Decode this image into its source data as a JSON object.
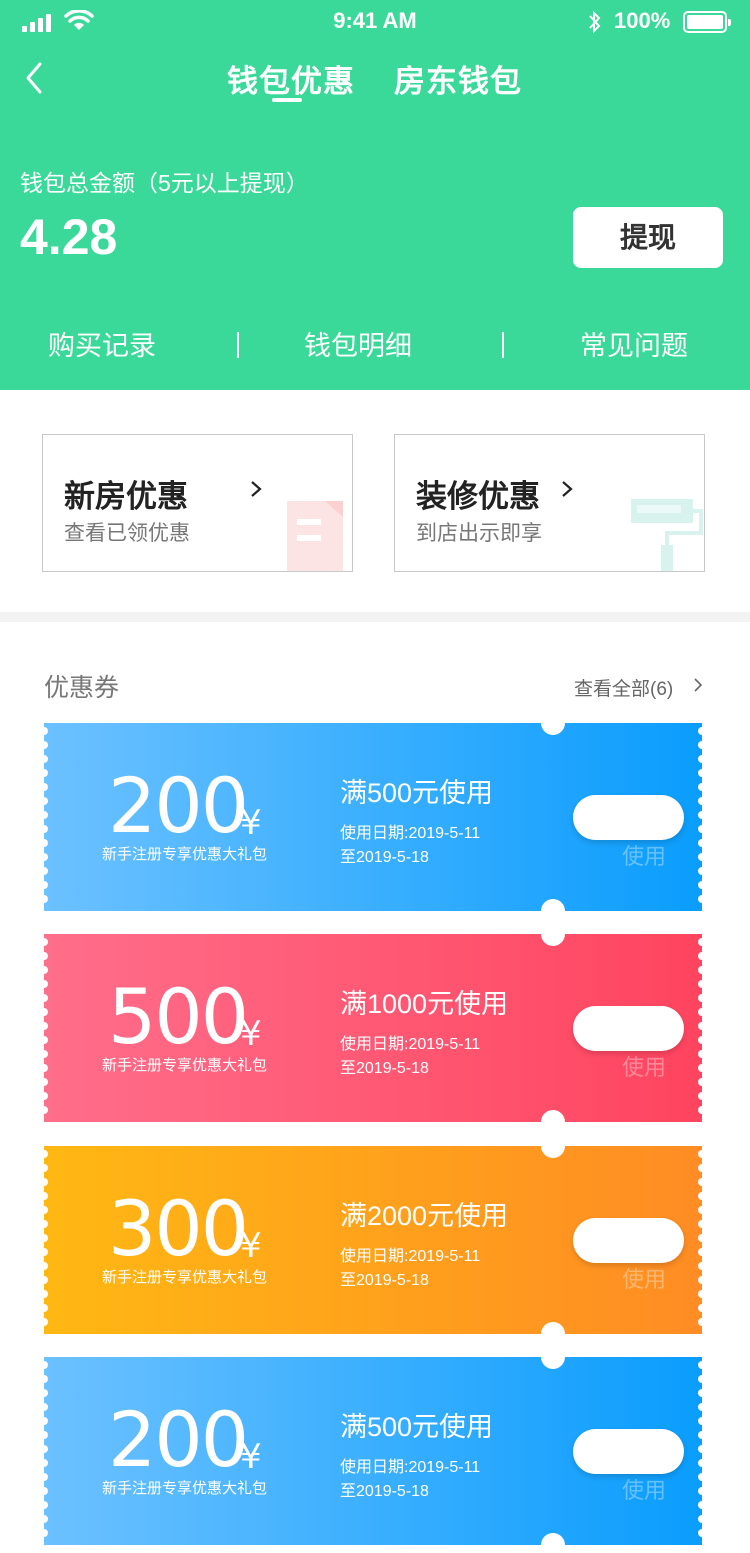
{
  "status_bar": {
    "time": "9:41 AM",
    "battery": "100%"
  },
  "nav": {
    "tabs": [
      "钱包优惠",
      "房东钱包"
    ]
  },
  "wallet": {
    "total_label": "钱包总金额（5元以上提现）",
    "total_amount": "4.28",
    "withdraw_label": "提现"
  },
  "links": [
    "购买记录",
    "钱包明细",
    "常见问题"
  ],
  "promos": [
    {
      "title": "新房优惠",
      "subtitle": "查看已领优惠"
    },
    {
      "title": "装修优惠",
      "subtitle": "到店出示即享"
    }
  ],
  "coupons_section": {
    "title": "优惠券",
    "view_all": "查看全部(6)"
  },
  "coupons": [
    {
      "amount": "200",
      "currency": "¥",
      "desc": "新手注册专享优惠大礼包",
      "condition": "满500元使用",
      "date_line1": "使用日期:2019-5-11",
      "date_line2": "至2019-5-18",
      "use_label": "使用",
      "colors": [
        "#6cc1ff",
        "#0a9dfd"
      ]
    },
    {
      "amount": "500",
      "currency": "¥",
      "desc": "新手注册专享优惠大礼包",
      "condition": "满1000元使用",
      "date_line1": "使用日期:2019-5-11",
      "date_line2": "至2019-5-18",
      "use_label": "使用",
      "colors": [
        "#ff6e8a",
        "#ff445f"
      ]
    },
    {
      "amount": "300",
      "currency": "¥",
      "desc": "新手注册专享优惠大礼包",
      "condition": "满2000元使用",
      "date_line1": "使用日期:2019-5-11",
      "date_line2": "至2019-5-18",
      "use_label": "使用",
      "colors": [
        "#ffb813",
        "#ff8c24"
      ]
    },
    {
      "amount": "200",
      "currency": "¥",
      "desc": "新手注册专享优惠大礼包",
      "condition": "满500元使用",
      "date_line1": "使用日期:2019-5-11",
      "date_line2": "至2019-5-18",
      "use_label": "使用",
      "colors": [
        "#6cc1ff",
        "#0a9dfd"
      ]
    }
  ],
  "theme": {
    "header_bg": "#3ad999"
  }
}
